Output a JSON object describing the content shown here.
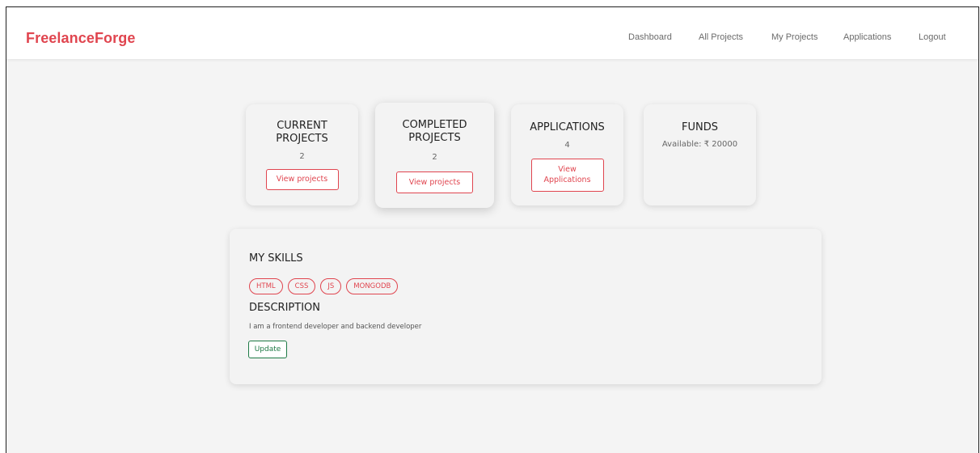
{
  "navbar": {
    "brand": "FreelanceForge",
    "links": [
      "Dashboard",
      "All Projects",
      "My Projects",
      "Applications",
      "Logout"
    ]
  },
  "cards": {
    "current": {
      "title_line1": "CURRENT",
      "title_line2": "PROJECTS",
      "value": "2",
      "button": "View projects"
    },
    "completed": {
      "title_line1": "COMPLETED",
      "title_line2": "PROJECTS",
      "value": "2",
      "button": "View projects"
    },
    "applications": {
      "title": "APPLICATIONS",
      "value": "4",
      "button_line1": "View",
      "button_line2": "Applications"
    },
    "funds": {
      "title": "FUNDS",
      "value": "Available: ₹ 20000"
    }
  },
  "profile": {
    "skills_title": "MY SKILLS",
    "skills": [
      "HTML",
      "CSS",
      "JS",
      "MONGODB"
    ],
    "description_title": "DESCRIPTION",
    "description": "I am a frontend developer and backend developer",
    "update_button": "Update"
  },
  "colors": {
    "accent_red": "#e0454f",
    "accent_green": "#1e7a45",
    "background": "#f4f4f4"
  }
}
